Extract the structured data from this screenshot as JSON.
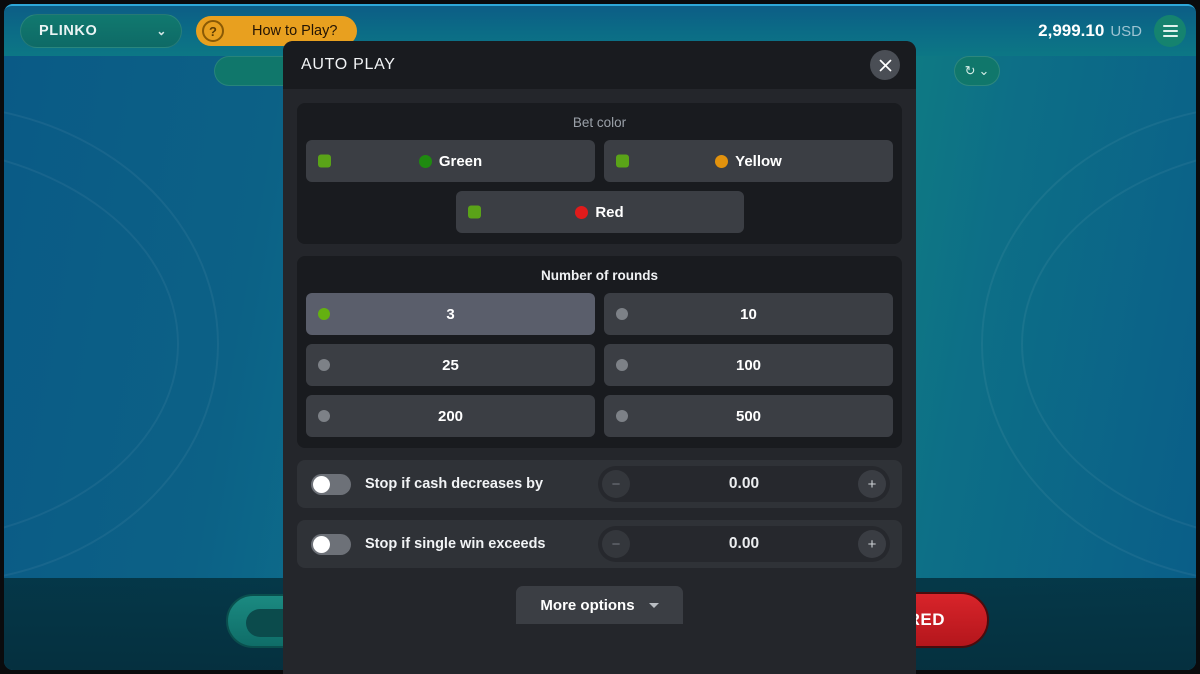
{
  "topbar": {
    "game_name": "PLINKO",
    "game_chevron_icon": "chevron-down-icon",
    "howto_label": "How to Play?",
    "howto_icon": "question-mark-icon",
    "balance_amount": "2,999.10",
    "balance_currency": "USD",
    "menu_icon": "hamburger-menu-icon",
    "history_icon": "history-clock-icon",
    "history_chevron_icon": "chevron-down-icon"
  },
  "game": {
    "bet_button_red_label": "RED"
  },
  "modal": {
    "title": "AUTO PLAY",
    "close_icon": "close-x-icon",
    "bet_color": {
      "title": "Bet color",
      "options": [
        {
          "label": "Green",
          "dot_color": "#1f8a10",
          "marker": "square",
          "checked": true
        },
        {
          "label": "Yellow",
          "dot_color": "#e2920d",
          "marker": "square",
          "checked": true
        },
        {
          "label": "Red",
          "dot_color": "#e01b1b",
          "marker": "square",
          "checked": true
        }
      ]
    },
    "rounds": {
      "title": "Number of rounds",
      "options": [
        {
          "label": "3",
          "selected": true
        },
        {
          "label": "10",
          "selected": false
        },
        {
          "label": "25",
          "selected": false
        },
        {
          "label": "100",
          "selected": false
        },
        {
          "label": "200",
          "selected": false
        },
        {
          "label": "500",
          "selected": false
        }
      ]
    },
    "stop_rules": [
      {
        "label": "Stop if cash decreases by",
        "enabled": false,
        "value": "0.00",
        "minus_label": "−",
        "plus_label": "+"
      },
      {
        "label": "Stop if single win exceeds",
        "enabled": false,
        "value": "0.00",
        "minus_label": "−",
        "plus_label": "+"
      }
    ],
    "more_options_label": "More options",
    "more_options_icon": "caret-down-icon"
  },
  "colors": {
    "accent_green": "#64b011",
    "accent_red": "#d8242a",
    "accent_orange": "#e8a01f",
    "panel_bg": "#191b1f",
    "modal_bg": "#24262b"
  }
}
